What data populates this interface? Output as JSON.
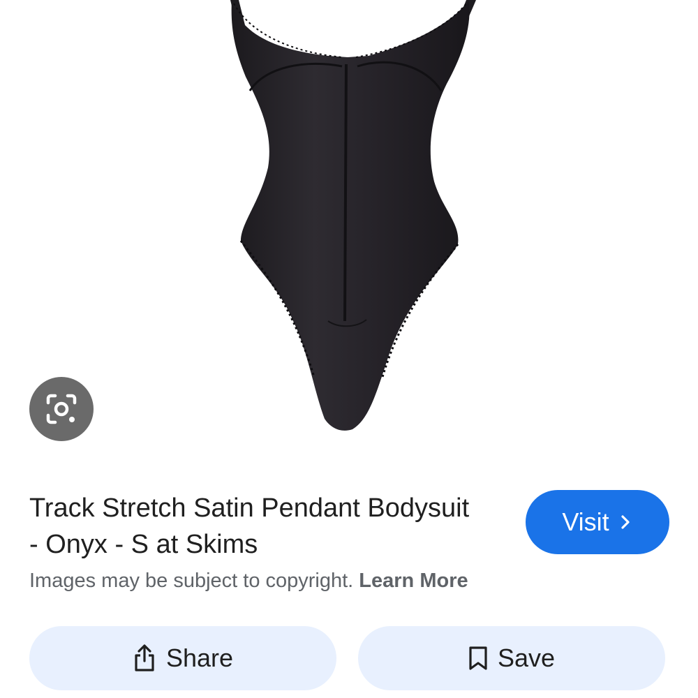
{
  "product": {
    "title": "Track Stretch Satin Pendant Bodysuit - Onyx - S at Skims",
    "image_icon": "bodysuit-product-image"
  },
  "lens": {
    "icon": "camera-lens-icon"
  },
  "visit": {
    "label": "Visit",
    "icon": "chevron-right-icon",
    "color": "#1a73e8"
  },
  "notice": {
    "text": "Images may be subject to copyright. ",
    "link_label": "Learn More"
  },
  "actions": {
    "share_label": "Share",
    "share_icon": "share-icon",
    "save_label": "Save",
    "save_icon": "bookmark-icon",
    "button_bg": "#e8f0fe"
  }
}
